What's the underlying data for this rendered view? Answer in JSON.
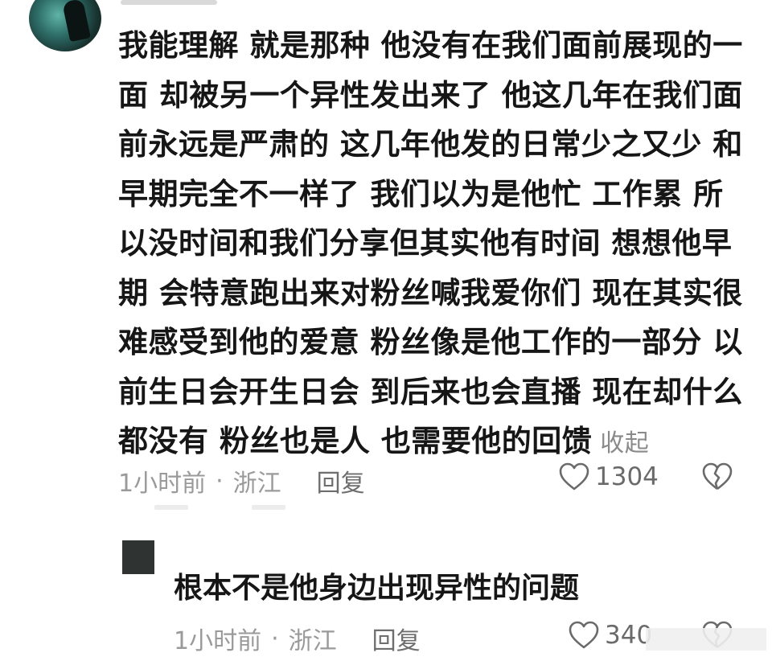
{
  "comment": {
    "text": "我能理解 就是那种 他没有在我们面前展现的一面 却被另一个异性发出来了 他这几年在我们面前永远是严肃的 这几年他发的日常少之又少 和早期完全不一样了 我们以为是他忙 工作累 所以没时间和我们分享但其实他有时间 想想他早期 会特意跑出来对粉丝喊我爱你们 现在其实很难感受到他的爱意 粉丝像是他工作的一部分 以前生日会开生日会 到后来也会直播 现在却什么都没有 粉丝也是人 也需要他的回馈",
    "collapse_label": "收起",
    "time": "1小时前",
    "separator": "·",
    "location": "浙江",
    "reply_label": "回复",
    "likes": "1304",
    "icons": {
      "avatar": "avatar",
      "like": "heart-icon",
      "dislike": "broken-heart-icon"
    }
  },
  "reply": {
    "text": "根本不是他身边出现异性的问题",
    "time": "1小时前",
    "separator": "·",
    "location": "浙江",
    "reply_label": "回复",
    "likes": "340",
    "icons": {
      "avatar": "avatar",
      "like": "heart-icon",
      "dislike": "broken-heart-icon"
    }
  },
  "colors": {
    "text": "#161616",
    "meta": "#9a9a9a",
    "reply_link": "#6e6e6e",
    "icon": "#6a6a6a"
  }
}
